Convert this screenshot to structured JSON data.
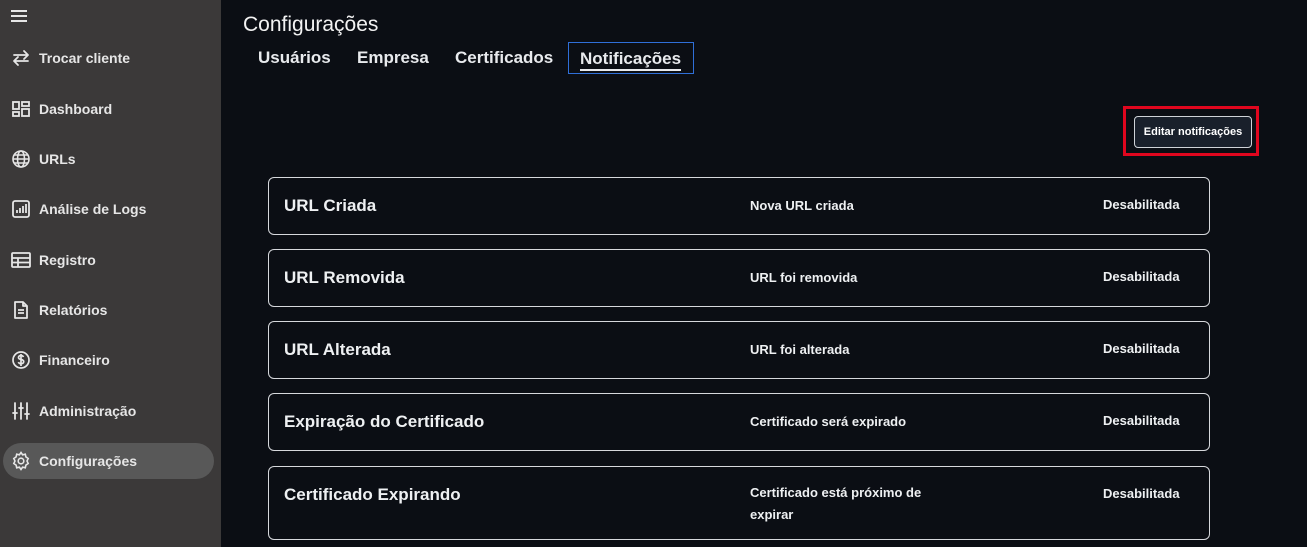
{
  "sidebar": {
    "items": [
      {
        "label": "Trocar cliente",
        "icon": "swap-icon"
      },
      {
        "label": "Dashboard",
        "icon": "dashboard-icon"
      },
      {
        "label": "URLs",
        "icon": "globe-icon"
      },
      {
        "label": "Análise de Logs",
        "icon": "chart-icon"
      },
      {
        "label": "Registro",
        "icon": "table-icon"
      },
      {
        "label": "Relatórios",
        "icon": "document-icon"
      },
      {
        "label": "Financeiro",
        "icon": "dollar-icon"
      },
      {
        "label": "Administração",
        "icon": "sliders-icon"
      },
      {
        "label": "Configurações",
        "icon": "gear-icon",
        "active": true
      }
    ]
  },
  "page": {
    "title": "Configurações"
  },
  "tabs": [
    {
      "label": "Usuários"
    },
    {
      "label": "Empresa"
    },
    {
      "label": "Certificados"
    },
    {
      "label": "Notificações",
      "active": true
    }
  ],
  "toolbar": {
    "edit_label": "Editar notificações"
  },
  "notifications": [
    {
      "name": "URL Criada",
      "description": "Nova URL criada",
      "status": "Desabilitada"
    },
    {
      "name": "URL Removida",
      "description": "URL foi removida",
      "status": "Desabilitada"
    },
    {
      "name": "URL Alterada",
      "description": "URL foi alterada",
      "status": "Desabilitada"
    },
    {
      "name": "Expiração do Certificado",
      "description": "Certificado será expirado",
      "status": "Desabilitada"
    },
    {
      "name": "Certificado Expirando",
      "description": "Certificado está próximo de expirar",
      "status": "Desabilitada"
    }
  ],
  "colors": {
    "highlight": "#e0061e",
    "active_tab_border": "#2f6fd8",
    "sidebar_bg": "#3b3939",
    "main_bg": "#0b0e14"
  }
}
